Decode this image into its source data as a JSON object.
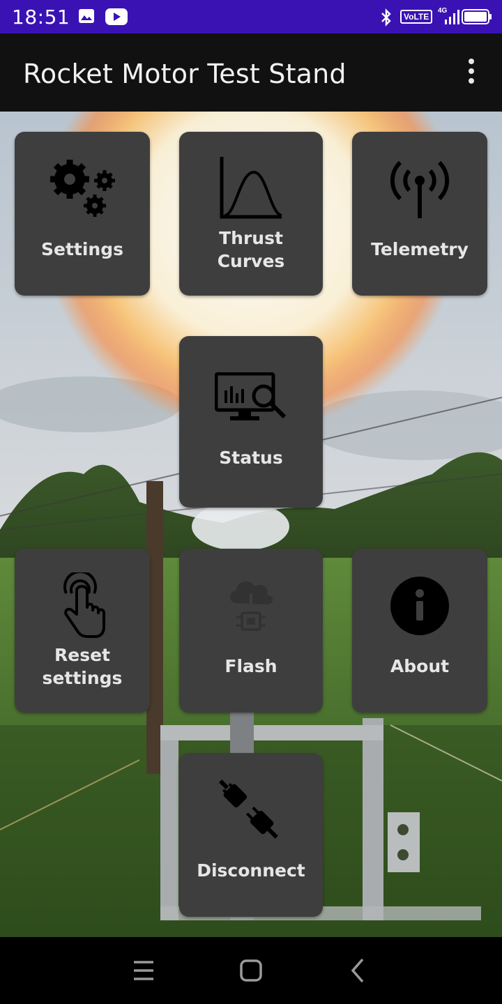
{
  "status_bar": {
    "time": "18:51",
    "icons": [
      "image-icon",
      "youtube-icon",
      "bluetooth-icon",
      "volte-icon",
      "signal-icon",
      "battery-icon"
    ],
    "volte_label": "VoLTE",
    "network_label": "4G"
  },
  "app_bar": {
    "title": "Rocket Motor Test Stand",
    "menu_icon": "more-vert-icon"
  },
  "tiles": {
    "settings": {
      "label": "Settings",
      "icon": "gears-icon"
    },
    "thrust_curves": {
      "label_line1": "Thrust",
      "label_line2": "Curves",
      "icon": "curve-chart-icon"
    },
    "telemetry": {
      "label": "Telemetry",
      "icon": "antenna-icon"
    },
    "status": {
      "label": "Status",
      "icon": "monitor-search-icon"
    },
    "reset_settings": {
      "label_line1": "Reset",
      "label_line2": "settings",
      "icon": "touch-hand-icon"
    },
    "flash": {
      "label": "Flash",
      "icon": "cloud-chip-icon"
    },
    "about": {
      "label": "About",
      "icon": "info-icon"
    },
    "disconnect": {
      "label": "Disconnect",
      "icon": "unplug-icon"
    }
  },
  "nav_bar": {
    "items": [
      "menu-icon",
      "home-icon",
      "back-icon"
    ]
  },
  "colors": {
    "status_bar": "#3a12b4",
    "app_bar": "#111111",
    "tile": "#3e3e3e",
    "tile_text": "#e6e6e6"
  }
}
